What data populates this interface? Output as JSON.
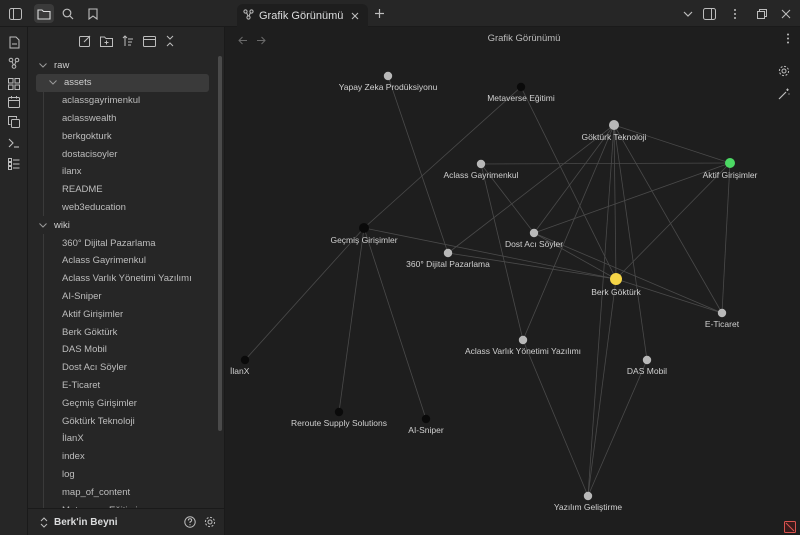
{
  "tab": {
    "title": "Grafik Görünümü"
  },
  "header": {
    "title": "Grafik Görünümü"
  },
  "colors": {
    "accent_yellow": "#f5d547",
    "accent_green": "#4cd964",
    "node_grey": "#b8b8b8",
    "node_black": "#0a0a0a",
    "edge": "#4a4a4a"
  },
  "sidebar": {
    "footer": {
      "vault_name": "Berk'in Beyni"
    },
    "tree": [
      {
        "label": "raw",
        "type": "folder",
        "depth": 0
      },
      {
        "label": "assets",
        "type": "folder",
        "depth": 1,
        "selected": true
      },
      {
        "label": "aclassgayrimenkul",
        "type": "file",
        "depth": 1
      },
      {
        "label": "aclasswealth",
        "type": "file",
        "depth": 1
      },
      {
        "label": "berkgokturk",
        "type": "file",
        "depth": 1
      },
      {
        "label": "dostacisoyler",
        "type": "file",
        "depth": 1
      },
      {
        "label": "ilanx",
        "type": "file",
        "depth": 1
      },
      {
        "label": "README",
        "type": "file",
        "depth": 1
      },
      {
        "label": "web3education",
        "type": "file",
        "depth": 1
      },
      {
        "label": "wiki",
        "type": "folder",
        "depth": 0
      },
      {
        "label": "360° Dijital Pazarlama",
        "type": "file",
        "depth": 1
      },
      {
        "label": "Aclass Gayrimenkul",
        "type": "file",
        "depth": 1
      },
      {
        "label": "Aclass Varlık Yönetimi Yazılımı",
        "type": "file",
        "depth": 1
      },
      {
        "label": "AI-Sniper",
        "type": "file",
        "depth": 1
      },
      {
        "label": "Aktif Girişimler",
        "type": "file",
        "depth": 1
      },
      {
        "label": "Berk Göktürk",
        "type": "file",
        "depth": 1
      },
      {
        "label": "DAS Mobil",
        "type": "file",
        "depth": 1
      },
      {
        "label": "Dost Acı Söyler",
        "type": "file",
        "depth": 1
      },
      {
        "label": "E-Ticaret",
        "type": "file",
        "depth": 1
      },
      {
        "label": "Geçmiş Girişimler",
        "type": "file",
        "depth": 1
      },
      {
        "label": "Göktürk Teknoloji",
        "type": "file",
        "depth": 1
      },
      {
        "label": "İlanX",
        "type": "file",
        "depth": 1
      },
      {
        "label": "index",
        "type": "file",
        "depth": 1
      },
      {
        "label": "log",
        "type": "file",
        "depth": 1
      },
      {
        "label": "map_of_content",
        "type": "file",
        "depth": 1
      },
      {
        "label": "Metaverse Eğitimi",
        "type": "file",
        "depth": 1
      }
    ]
  },
  "graph": {
    "nodes": [
      {
        "id": "yapay",
        "label": "Yapay Zeka Prodüksiyonu",
        "color": "grey"
      },
      {
        "id": "metaverse",
        "label": "Metaverse Eğitimi",
        "color": "black"
      },
      {
        "id": "gokturk",
        "label": "Göktürk Teknoloji",
        "color": "grey"
      },
      {
        "id": "aktif",
        "label": "Aktif Girişimler",
        "color": "green"
      },
      {
        "id": "aclassg",
        "label": "Aclass Gayrimenkul",
        "color": "grey"
      },
      {
        "id": "dost",
        "label": "Dost Acı Söyler",
        "color": "grey"
      },
      {
        "id": "gecmis",
        "label": "Geçmiş Girişimler",
        "color": "black"
      },
      {
        "id": "pazarlama",
        "label": "360° Dijital Pazarlama",
        "color": "grey"
      },
      {
        "id": "berk",
        "label": "Berk Göktürk",
        "color": "yellow"
      },
      {
        "id": "eticaret",
        "label": "E-Ticaret",
        "color": "grey"
      },
      {
        "id": "aclassv",
        "label": "Aclass Varlık Yönetimi Yazılımı",
        "color": "grey"
      },
      {
        "id": "das",
        "label": "DAS Mobil",
        "color": "grey"
      },
      {
        "id": "ilanx",
        "label": "İlanX",
        "color": "black"
      },
      {
        "id": "reroute",
        "label": "Reroute Supply Solutions",
        "color": "black"
      },
      {
        "id": "sniper",
        "label": "AI-Sniper",
        "color": "black"
      },
      {
        "id": "yazilim",
        "label": "Yazılım Geliştirme",
        "color": "grey"
      }
    ],
    "edges": [
      [
        "yapay",
        "pazarlama"
      ],
      [
        "metaverse",
        "gecmis"
      ],
      [
        "metaverse",
        "berk"
      ],
      [
        "gokturk",
        "aktif"
      ],
      [
        "gokturk",
        "dost"
      ],
      [
        "gokturk",
        "berk"
      ],
      [
        "gokturk",
        "aclassv"
      ],
      [
        "gokturk",
        "das"
      ],
      [
        "gokturk",
        "eticaret"
      ],
      [
        "gokturk",
        "yazilim"
      ],
      [
        "gokturk",
        "pazarlama"
      ],
      [
        "aclassg",
        "aktif"
      ],
      [
        "aclassg",
        "aclassv"
      ],
      [
        "aclassg",
        "dost"
      ],
      [
        "aktif",
        "berk"
      ],
      [
        "aktif",
        "eticaret"
      ],
      [
        "aktif",
        "dost"
      ],
      [
        "dost",
        "berk"
      ],
      [
        "dost",
        "eticaret"
      ],
      [
        "gecmis",
        "ilanx"
      ],
      [
        "gecmis",
        "reroute"
      ],
      [
        "gecmis",
        "sniper"
      ],
      [
        "gecmis",
        "berk"
      ],
      [
        "berk",
        "eticaret"
      ],
      [
        "berk",
        "yazilim"
      ],
      [
        "berk",
        "pazarlama"
      ],
      [
        "aclassv",
        "yazilim"
      ],
      [
        "das",
        "yazilim"
      ]
    ]
  }
}
